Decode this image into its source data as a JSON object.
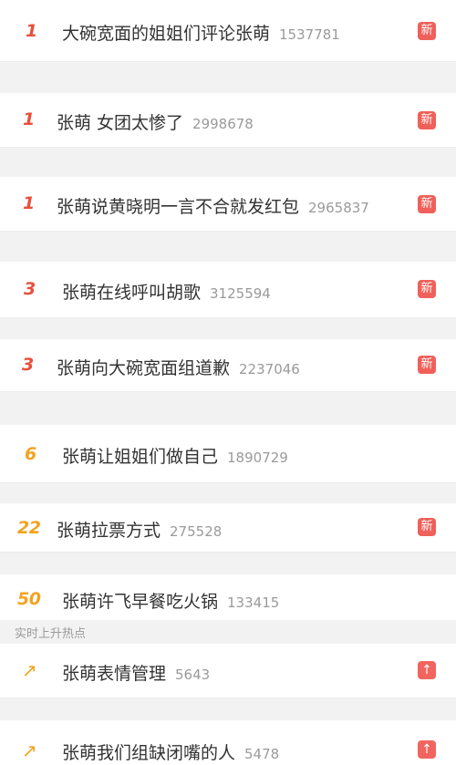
{
  "hot_list": [
    {
      "rank": "1",
      "title": "大碗宽面的姐姐们评论张萌",
      "count": "1537781",
      "badge": "新"
    },
    {
      "rank": "1",
      "title": "张萌 女团太惨了",
      "count": "2998678",
      "badge": "新"
    },
    {
      "rank": "1",
      "title": "张萌说黄晓明一言不合就发红包",
      "count": "2965837",
      "badge": "新"
    },
    {
      "rank": "3",
      "title": "张萌在线呼叫胡歌",
      "count": "3125594",
      "badge": "新"
    },
    {
      "rank": "3",
      "title": "张萌向大碗宽面组道歉",
      "count": "2237046",
      "badge": "新"
    },
    {
      "rank": "6",
      "title": "张萌让姐姐们做自己",
      "count": "1890729",
      "badge": ""
    },
    {
      "rank": "22",
      "title": "张萌拉票方式",
      "count": "275528",
      "badge": "新"
    },
    {
      "rank": "50",
      "title": "张萌许飞早餐吃火锅",
      "count": "133415",
      "badge": ""
    }
  ],
  "section_header": "实时上升热点",
  "rising_list": [
    {
      "rank": "↗",
      "title": "张萌表情管理",
      "count": "5643",
      "badge": "↑"
    },
    {
      "rank": "↗",
      "title": "张萌我们组缺闭嘴的人",
      "count": "5478",
      "badge": "↑"
    }
  ],
  "colors": {
    "rank_top": "#e8503c",
    "rank_other": "#f3a321",
    "badge": "#f0605a",
    "title": "#333333",
    "count": "#9a9a9a"
  }
}
